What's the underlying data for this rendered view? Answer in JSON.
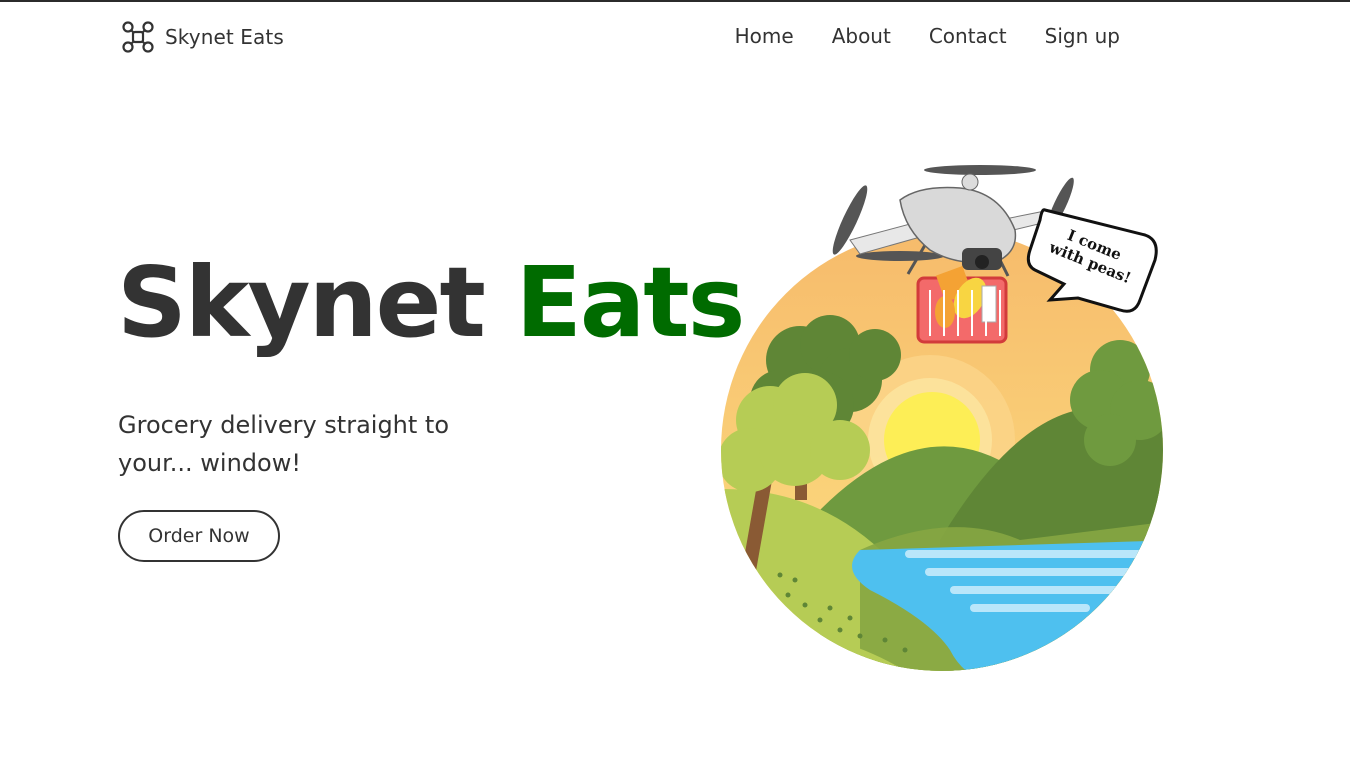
{
  "nav": {
    "brand_name": "Skynet Eats",
    "brand_icon": "drone-icon",
    "links": [
      {
        "label": "Home"
      },
      {
        "label": "About"
      },
      {
        "label": "Contact"
      },
      {
        "label": "Sign up"
      }
    ]
  },
  "hero": {
    "title_main": "Skynet",
    "title_accent": "Eats",
    "tagline": "Grocery delivery straight to your... window!",
    "cta_label": "Order Now",
    "speech_bubble": "I come with peas!"
  },
  "colors": {
    "accent_green": "#006b00",
    "text_dark": "#333333"
  }
}
